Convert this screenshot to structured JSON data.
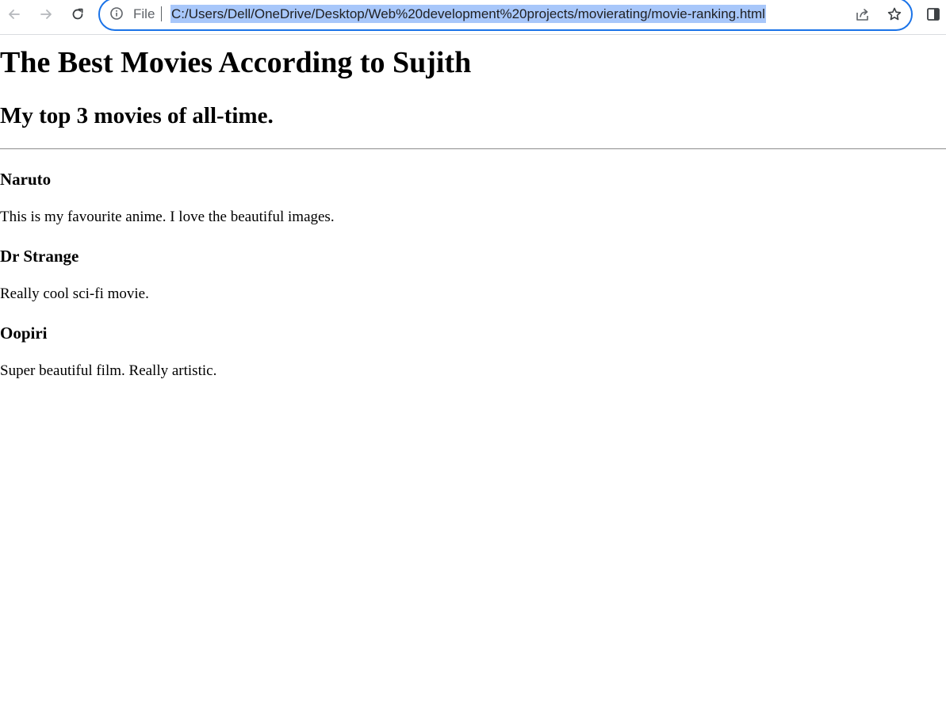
{
  "browser": {
    "scheme_label": "File",
    "url": "C:/Users/Dell/OneDrive/Desktop/Web%20development%20projects/movierating/movie-ranking.html",
    "icons": {
      "back": "arrow-left-icon",
      "forward": "arrow-right-icon",
      "reload": "reload-icon",
      "site_info": "info-icon",
      "share": "share-icon",
      "bookmark": "star-icon",
      "side_panel": "side-panel-icon"
    },
    "accent_color": "#1a73e8",
    "selection_color": "#a8c7fa"
  },
  "page": {
    "heading": "The Best Movies According to Sujith",
    "subheading": "My top 3 movies of all-time.",
    "movies": [
      {
        "title": "Naruto",
        "description": "This is my favourite anime. I love the beautiful images."
      },
      {
        "title": "Dr Strange",
        "description": "Really cool sci-fi movie."
      },
      {
        "title": "Oopiri",
        "description": "Super beautiful film. Really artistic."
      }
    ]
  }
}
